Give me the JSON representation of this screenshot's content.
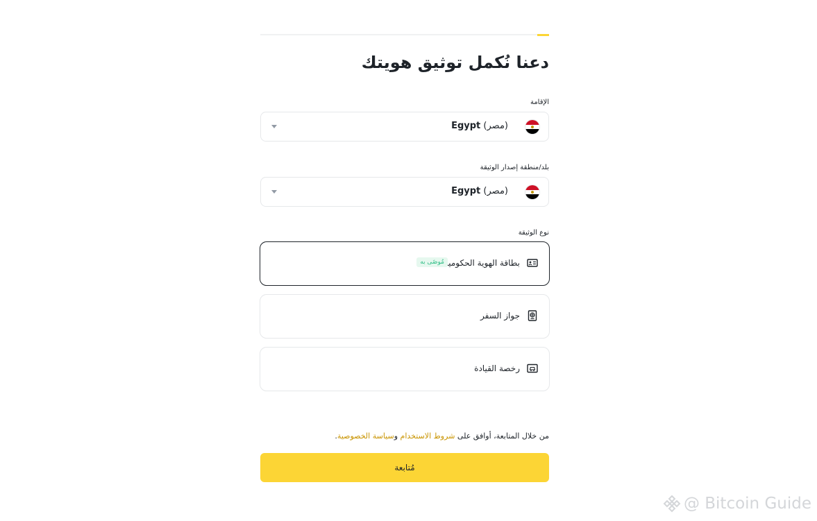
{
  "progress": {
    "fraction": 0.04
  },
  "title": "دعنا نُكمل توثيق هويتك",
  "residence": {
    "label": "الإقامة",
    "value_en": "Egypt",
    "value_ar": "(مصر)",
    "flag_icon": "egypt-flag-icon"
  },
  "issuing_country": {
    "label": "بلد/منطقة إصدار الوثيقة",
    "value_en": "Egypt",
    "value_ar": "(مصر)",
    "flag_icon": "egypt-flag-icon"
  },
  "document_type": {
    "label": "نوع الوثيقة",
    "options": [
      {
        "label": "بطاقة الهوية الحكومية",
        "badge": "مُوصًى به",
        "icon": "id-card-icon",
        "selected": true
      },
      {
        "label": "جواز السفر",
        "icon": "passport-icon",
        "selected": false
      },
      {
        "label": "رخصة القيادة",
        "icon": "drivers-license-icon",
        "selected": false
      }
    ]
  },
  "terms": {
    "prefix": "من خلال المتابعة، أوافق على ",
    "terms_link": "شروط الاستخدام",
    "conjunction": " و",
    "privacy_link": "سياسة الخصوصية",
    "suffix": "."
  },
  "continue_label": "مُتابعة",
  "watermark": "@ Bitcoin Guide",
  "colors": {
    "accent": "#fcd535",
    "link": "#c99400",
    "badge_text": "#2ebd85",
    "badge_bg": "#e6f8ef"
  }
}
